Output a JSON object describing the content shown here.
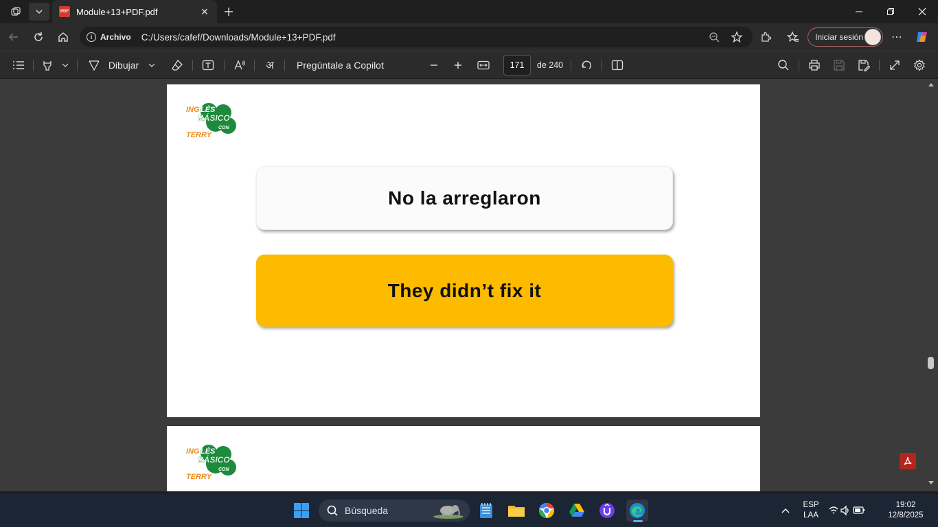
{
  "browser": {
    "tab_title": "Module+13+PDF.pdf",
    "address_source": "Archivo",
    "url": "C:/Users/cafef/Downloads/Module+13+PDF.pdf",
    "signin_label": "Iniciar sesión"
  },
  "pdf_toolbar": {
    "draw_label": "Dibujar",
    "copilot_label": "Pregúntale a Copilot",
    "current_page": "171",
    "page_total": "de 240"
  },
  "document": {
    "logo_text": [
      "INGLÉS",
      "BÁSICO",
      "CON",
      "TERRY"
    ],
    "spanish_phrase": "No la arreglaron",
    "english_phrase": "They didn’t fix it"
  },
  "taskbar": {
    "search_placeholder": "Búsqueda",
    "language": "ESP",
    "layout": "LAA",
    "time": "19:02",
    "date": "12/8/2025"
  },
  "colors": {
    "accent_card": "#fdbb00",
    "logo_green": "#1e8a3c",
    "logo_orange": "#f08a1c"
  }
}
